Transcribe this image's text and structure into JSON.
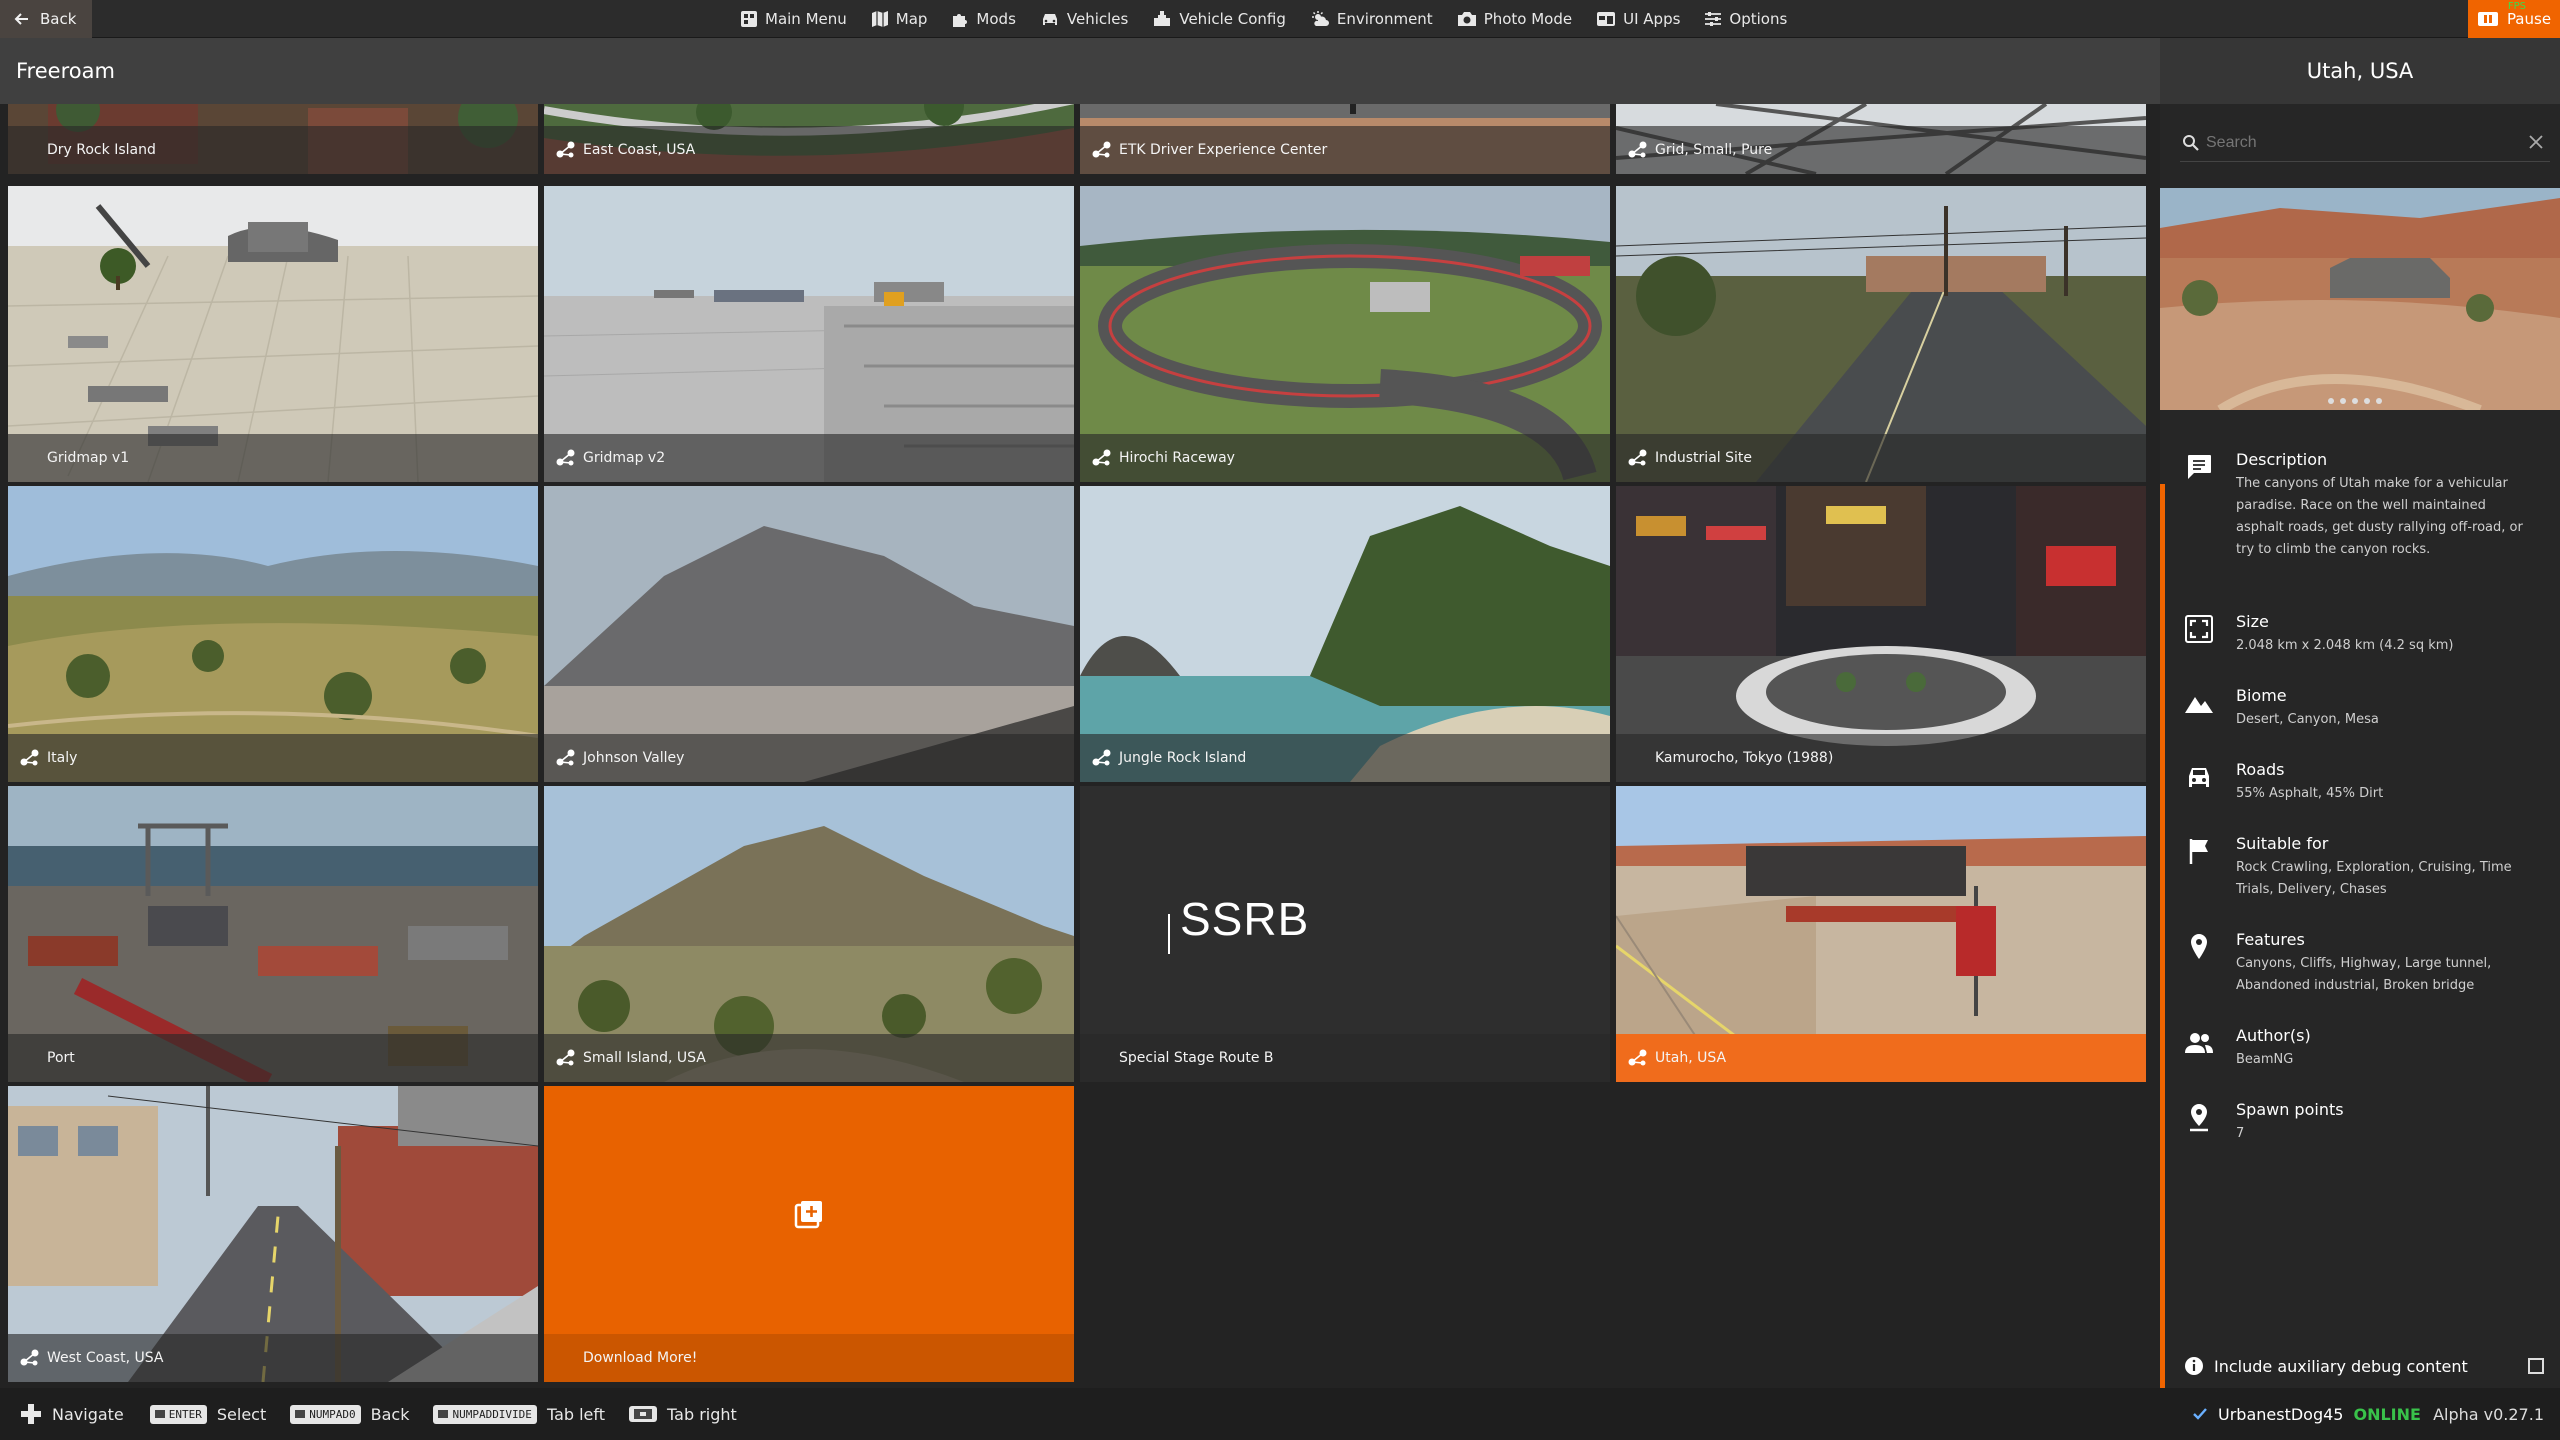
{
  "topbar": {
    "back_label": "Back",
    "nav": [
      {
        "label": "Main Menu",
        "icon": "main-menu-icon"
      },
      {
        "label": "Map",
        "icon": "map-icon"
      },
      {
        "label": "Mods",
        "icon": "puzzle-icon"
      },
      {
        "label": "Vehicles",
        "icon": "car-icon"
      },
      {
        "label": "Vehicle Config",
        "icon": "vehicle-config-icon"
      },
      {
        "label": "Environment",
        "icon": "weather-icon"
      },
      {
        "label": "Photo Mode",
        "icon": "camera-icon"
      },
      {
        "label": "UI Apps",
        "icon": "ui-apps-icon"
      },
      {
        "label": "Options",
        "icon": "sliders-icon"
      }
    ],
    "pause_label": "Pause",
    "fps_label": "FPS"
  },
  "page_title": "Freeroam",
  "levels": [
    {
      "name": "Dry Rock Island",
      "mod": false
    },
    {
      "name": "East Coast, USA",
      "mod": true
    },
    {
      "name": "ETK Driver Experience Center",
      "mod": true
    },
    {
      "name": "Grid, Small, Pure",
      "mod": true
    },
    {
      "name": "Gridmap v1",
      "mod": false
    },
    {
      "name": "Gridmap v2",
      "mod": true
    },
    {
      "name": "Hirochi Raceway",
      "mod": true
    },
    {
      "name": "Industrial Site",
      "mod": true
    },
    {
      "name": "Italy",
      "mod": true
    },
    {
      "name": "Johnson Valley",
      "mod": true
    },
    {
      "name": "Jungle Rock Island",
      "mod": true
    },
    {
      "name": "Kamurocho, Tokyo (1988)",
      "mod": false
    },
    {
      "name": "Port",
      "mod": false
    },
    {
      "name": "Small Island, USA",
      "mod": true
    },
    {
      "name": "Special Stage Route B",
      "mod": false,
      "logo_text": "SSRB"
    },
    {
      "name": "Utah, USA",
      "mod": true
    },
    {
      "name": "West Coast, USA",
      "mod": true
    },
    {
      "name": "Download More!",
      "mod": false
    }
  ],
  "detail": {
    "title": "Utah, USA",
    "search_placeholder": "Search",
    "description_label": "Description",
    "description": "The canyons of Utah make for a vehicular paradise. Race on the well maintained asphalt roads, get dusty rallying off-road, or try to climb the canyon rocks.",
    "size_label": "Size",
    "size": "2.048 km x 2.048 km (4.2 sq km)",
    "biome_label": "Biome",
    "biome": "Desert, Canyon, Mesa",
    "roads_label": "Roads",
    "roads": "55% Asphalt, 45% Dirt",
    "suitable_label": "Suitable for",
    "suitable": "Rock Crawling, Exploration, Cruising, Time Trials, Delivery, Chases",
    "features_label": "Features",
    "features": "Canyons, Cliffs, Highway, Large tunnel, Abandoned industrial, Broken bridge",
    "authors_label": "Author(s)",
    "authors": "BeamNG",
    "spawn_label": "Spawn points",
    "spawn": "7",
    "debug_label": "Include auxiliary debug content"
  },
  "bottombar": {
    "navigate_label": "Navigate",
    "enter_key": "ENTER",
    "select_label": "Select",
    "numpad0_key": "NUMPAD0",
    "back_label": "Back",
    "numpaddivide_key": "NUMPADDIVIDE",
    "tab_left_label": "Tab left",
    "tab_right_label": "Tab right",
    "username": "UrbanestDog45",
    "status": "ONLINE",
    "version": "Alpha v0.27.1"
  },
  "colors": {
    "accent": "#f06400",
    "online": "#39c24a"
  }
}
